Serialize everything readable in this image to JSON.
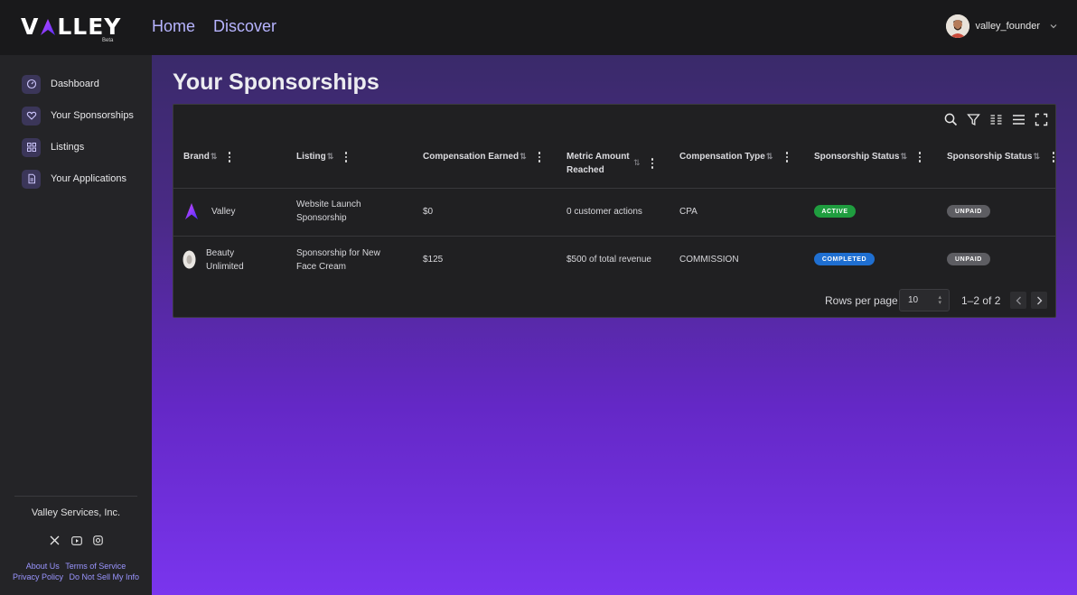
{
  "app": {
    "logo_text_left": "V",
    "logo_text_right": "LLEY",
    "logo_badge": "Beta",
    "nav": [
      {
        "label": "Home"
      },
      {
        "label": "Discover"
      }
    ],
    "user": {
      "name": "valley_founder"
    }
  },
  "sidebar": {
    "items": [
      {
        "label": "Dashboard",
        "icon": "dashboard-icon"
      },
      {
        "label": "Your Sponsorships",
        "icon": "heart-icon"
      },
      {
        "label": "Listings",
        "icon": "grid-icon"
      },
      {
        "label": "Your Applications",
        "icon": "document-icon"
      }
    ],
    "company": "Valley Services, Inc.",
    "socials": [
      "x-icon",
      "youtube-icon",
      "instagram-icon"
    ],
    "footer_links_row1": [
      "About Us",
      "Terms of Service"
    ],
    "footer_links_row2": [
      "Privacy Policy",
      "Do Not Sell My Info"
    ]
  },
  "main": {
    "title": "Your Sponsorships",
    "toolbar_icons": [
      "search-icon",
      "filter-icon",
      "columns-icon",
      "density-icon",
      "fullscreen-icon"
    ],
    "columns": [
      {
        "label": "Brand"
      },
      {
        "label": "Listing"
      },
      {
        "label": "Compensation Earned"
      },
      {
        "label_line1": "Metric Amount",
        "label_line2": "Reached"
      },
      {
        "label": "Compensation Type"
      },
      {
        "label": "Sponsorship Status"
      },
      {
        "label": "Sponsorship Status"
      }
    ],
    "rows": [
      {
        "brand": "Valley",
        "listing_line1": "Website Launch",
        "listing_line2": "Sponsorship",
        "compensation": "$0",
        "metric": "0 customer actions",
        "comp_type": "CPA",
        "status": "ACTIVE",
        "payment": "UNPAID"
      },
      {
        "brand_line1": "Beauty",
        "brand_line2": "Unlimited",
        "listing_line1": "Sponsorship for New",
        "listing_line2": "Face Cream",
        "compensation": "$125",
        "metric": "$500 of total revenue",
        "comp_type": "COMMISSION",
        "status": "COMPLETED",
        "payment": "UNPAID"
      }
    ],
    "pagination": {
      "rows_per_page_label": "Rows per page",
      "rows_per_page_value": "10",
      "range": "1–2 of 2"
    }
  },
  "colors": {
    "accent": "#b7b4ff",
    "active_badge": "#1f9d3f",
    "completed_badge": "#1f6fd1",
    "unpaid_badge": "#5d5d62"
  }
}
